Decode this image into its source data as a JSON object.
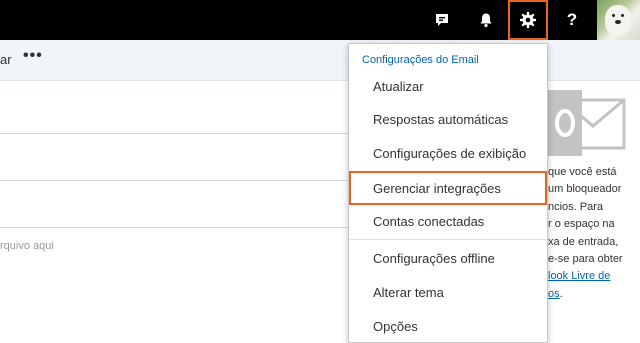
{
  "topbar": {
    "buttons": [
      {
        "icon": "chat-icon"
      },
      {
        "icon": "bell-icon"
      },
      {
        "icon": "gear-icon"
      },
      {
        "icon": "help-icon",
        "label": "?"
      }
    ],
    "highlight_color": "#e8641c"
  },
  "commandbar": {
    "partial_label": "ar",
    "more_label": "•••"
  },
  "list": {
    "drop_hint": "rquivo aqui"
  },
  "promo": {
    "lines": [
      "que você está",
      "um bloqueador",
      "ncios. Para",
      "r o espaço na",
      "xa de entrada,",
      "e-se para obter"
    ],
    "link_lines": [
      "look Livre de",
      "os"
    ],
    "trailing": "."
  },
  "settings_menu": {
    "header": "Configurações do Email",
    "items": [
      {
        "label": "Atualizar"
      },
      {
        "label": "Respostas automáticas"
      },
      {
        "label": "Configurações de exibição"
      },
      {
        "label": "Gerenciar integrações",
        "highlighted": true
      },
      {
        "label": "Contas conectadas"
      },
      {
        "label": "Configurações offline"
      },
      {
        "label": "Alterar tema"
      },
      {
        "label": "Opções"
      }
    ]
  }
}
